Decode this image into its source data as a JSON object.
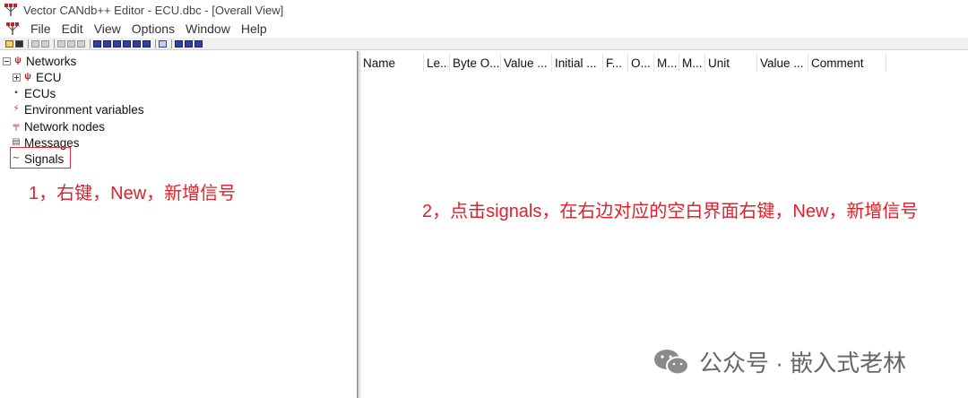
{
  "window": {
    "title": "Vector CANdb++ Editor - ECU.dbc - [Overall View]"
  },
  "menu": {
    "items": [
      "File",
      "Edit",
      "View",
      "Options",
      "Window",
      "Help"
    ]
  },
  "tree": {
    "items": [
      {
        "label": "Networks",
        "icon": "network-icon"
      },
      {
        "label": "ECU",
        "icon": "network-icon"
      },
      {
        "label": "ECUs",
        "icon": "ecu-icon"
      },
      {
        "label": "Environment variables",
        "icon": "env-var-icon"
      },
      {
        "label": "Network nodes",
        "icon": "node-icon"
      },
      {
        "label": "Messages",
        "icon": "message-icon"
      },
      {
        "label": "Signals",
        "icon": "signal-icon"
      }
    ]
  },
  "columns": [
    "Name",
    "Le...",
    "Byte O...",
    "Value ...",
    "Initial ...",
    "F...",
    "O...",
    "M...",
    "M...",
    "Unit",
    "Value ...",
    "Comment"
  ],
  "annotations": {
    "left": "1，右键，New，新增信号",
    "right": "2，点击signals，在右边对应的空白界面右键，New，新增信号"
  },
  "watermark": {
    "text": "公众号 · 嵌入式老林"
  },
  "colors": {
    "annotation": "#e0202a",
    "highlight_box": "#e0303a",
    "watermark": "#666666"
  }
}
